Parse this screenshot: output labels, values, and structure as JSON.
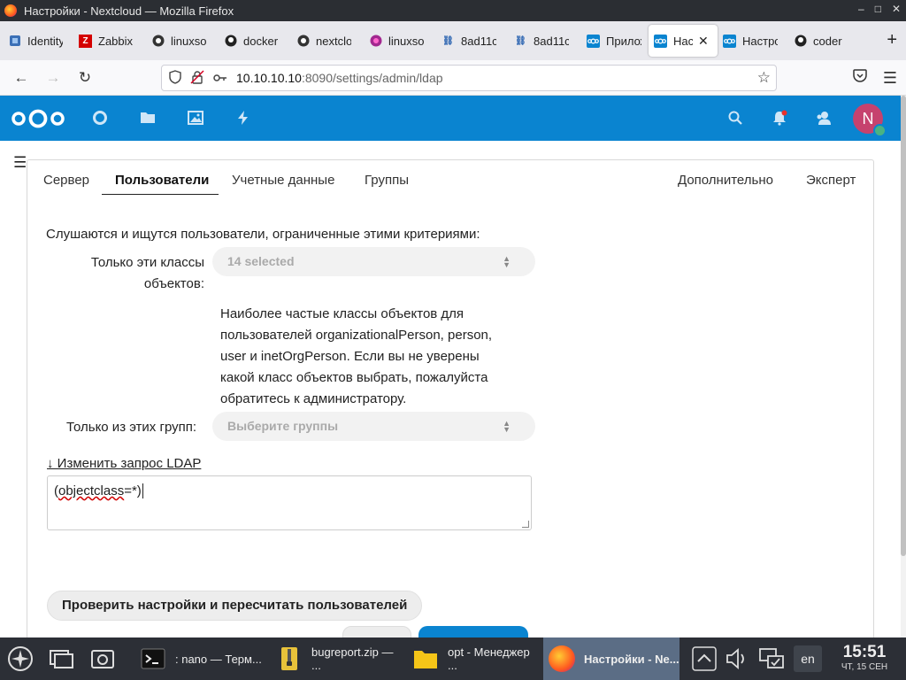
{
  "window": {
    "title": "Настройки - Nextcloud — Mozilla Firefox",
    "controls": [
      "–",
      "□",
      "✕"
    ]
  },
  "tabs": [
    {
      "label": "Identity",
      "icon": "identity-icon"
    },
    {
      "label": "Zabbix",
      "icon": "zabbix-icon"
    },
    {
      "label": "linuxsoft",
      "icon": "linux-icon"
    },
    {
      "label": "docker",
      "icon": "github-icon"
    },
    {
      "label": "nextcloud",
      "icon": "linux-icon"
    },
    {
      "label": "linuxsoft",
      "icon": "linux-icon"
    },
    {
      "label": "8ad11c",
      "icon": "link-icon"
    },
    {
      "label": "8ad11c",
      "icon": "link-icon"
    },
    {
      "label": "Приложения",
      "icon": "nextcloud-icon"
    },
    {
      "label": "Настройки",
      "icon": "nextcloud-icon",
      "active": true
    },
    {
      "label": "Настройки",
      "icon": "nextcloud-icon"
    },
    {
      "label": "coder",
      "icon": "github-icon"
    }
  ],
  "newtab": "+",
  "url": {
    "host": "10.10.10.10",
    "path": ":8090/settings/admin/ldap"
  },
  "ldap": {
    "tabs": [
      "Сервер",
      "Пользователи",
      "Учетные данные",
      "Группы",
      "Дополнительно",
      "Эксперт"
    ],
    "intro": "Слушаются и ищутся пользователи, ограниченные этими критериями:",
    "classes_label_1": "Только эти классы",
    "classes_label_2": "объектов:",
    "classes_value": "14 selected",
    "hint": "Наиболее частые классы объектов для пользователей organizationalPerson, person, user и inetOrgPerson. Если вы не уверены какой класс объектов выбрать, пожалуйста обратитесь к администратору.",
    "groups_label": "Только из этих групп:",
    "groups_placeholder": "Выберите группы",
    "edit_link": "↓ Изменить запрос LDAP",
    "query_word": "objectclass",
    "query_open": "(",
    "query_close": "=*)",
    "check_button": "Проверить настройки и пересчитать пользователей"
  },
  "taskbar": {
    "tasks": [
      {
        "label": ": nano — Терм...",
        "icon": "terminal-icon"
      },
      {
        "label": "bugreport.zip — ...",
        "icon": "archive-icon"
      },
      {
        "label": "opt - Менеджер ...",
        "icon": "folder-icon"
      },
      {
        "label": "Настройки - Ne...",
        "icon": "firefox-icon",
        "active": true
      }
    ],
    "lang": "en",
    "time": "15:51",
    "date": "ЧТ, 15 СЕН"
  },
  "colors": {
    "nextcloud_blue": "#0a84d0",
    "avatar": "#c6426e",
    "status_online": "#49b382",
    "taskbar": "#2c2f36",
    "active_task": "#5b6d85"
  }
}
